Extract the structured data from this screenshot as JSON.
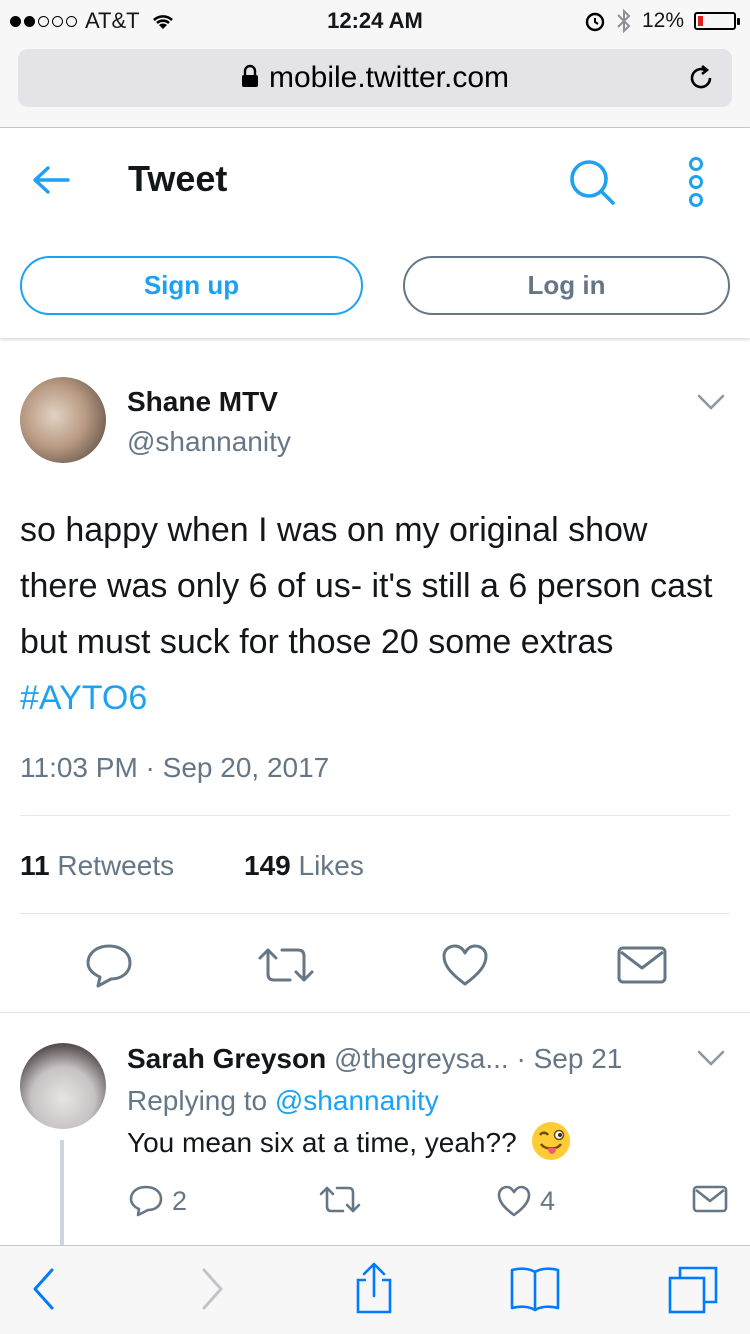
{
  "status_bar": {
    "carrier": "AT&T",
    "time": "12:24 AM",
    "battery": "12%",
    "battery_level": 0.12
  },
  "browser": {
    "url": "mobile.twitter.com"
  },
  "header": {
    "title": "Tweet",
    "signup_label": "Sign up",
    "login_label": "Log in"
  },
  "tweet": {
    "author_name": "Shane MTV",
    "author_handle": "@shannanity",
    "text": "so happy when I was on my original show there was only 6 of us-  it's still a 6 person cast but must suck for those 20 some extras ",
    "hashtag": "#AYTO6",
    "timestamp": "11:03 PM · Sep 20, 2017",
    "retweet_count": "11",
    "retweet_label": "Retweets",
    "like_count": "149",
    "like_label": "Likes"
  },
  "reply": {
    "author_name": "Sarah Greyson",
    "author_handle": "@thegreysa...",
    "date": "· Sep 21",
    "replying_label": "Replying to",
    "replying_handle": "@shannanity",
    "text": "You mean six at a time, yeah??",
    "reply_count": "2",
    "like_count": "4"
  },
  "colors": {
    "accent": "#1da1f2",
    "muted": "#657786",
    "text": "#14171a",
    "divider": "#e1e8ed"
  },
  "icons": {
    "back": "arrow-left-icon",
    "search": "search-icon",
    "more": "more-vertical-icon",
    "caret": "chevron-down-icon",
    "reply": "reply-icon",
    "retweet": "retweet-icon",
    "like": "heart-icon",
    "dm": "envelope-icon",
    "safari_back": "chevron-left-icon",
    "safari_forward": "chevron-right-icon",
    "share": "share-icon",
    "bookmarks": "book-icon",
    "tabs": "tabs-icon"
  }
}
